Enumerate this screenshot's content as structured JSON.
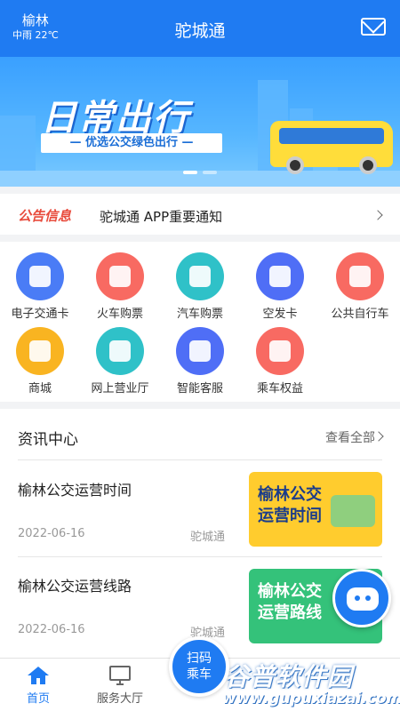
{
  "header": {
    "city": "榆林",
    "weather": "中雨 22℃",
    "title": "驼城通",
    "mail_icon": "mail-icon"
  },
  "banner": {
    "title": "日常出行",
    "subtitle": "— 优选公交绿色出行 —",
    "slides": 2,
    "active_slide": 1
  },
  "notice": {
    "tag": "公告信息",
    "text": "驼城通 APP重要通知"
  },
  "services": [
    {
      "label": "电子交通卡",
      "icon": "qr-card-icon",
      "color": "#4a7cf6"
    },
    {
      "label": "火车购票",
      "icon": "train-icon",
      "color": "#f86a62"
    },
    {
      "label": "汽车购票",
      "icon": "bus-icon",
      "color": "#2fc1c8"
    },
    {
      "label": "空发卡",
      "icon": "card-icon",
      "color": "#4f6ef6"
    },
    {
      "label": "公共自行车",
      "icon": "bicycle-icon",
      "color": "#f86a62"
    },
    {
      "label": "商城",
      "icon": "shopping-bag-icon",
      "color": "#f9b421"
    },
    {
      "label": "网上营业厅",
      "icon": "store-icon",
      "color": "#2fc1c8"
    },
    {
      "label": "智能客服",
      "icon": "robot-icon",
      "color": "#4f6ef6"
    },
    {
      "label": "乘车权益",
      "icon": "diamond-icon",
      "color": "#f86a62"
    }
  ],
  "news": {
    "title": "资讯中心",
    "more": "查看全部",
    "items": [
      {
        "title": "榆林公交运营时间",
        "date": "2022-06-16",
        "source": "驼城通",
        "thumb_text": "榆林公交运营时间"
      },
      {
        "title": "榆林公交运营线路",
        "date": "2022-06-16",
        "source": "驼城通",
        "thumb_text": "榆林公交运营路线"
      }
    ]
  },
  "scan": {
    "line1": "扫码",
    "line2": "乘车"
  },
  "tabs": [
    {
      "label": "首页",
      "icon": "home-icon",
      "active": true
    },
    {
      "label": "服务大厅",
      "icon": "monitor-icon",
      "active": false
    }
  ],
  "watermark": {
    "text": "谷普软件园",
    "url": "www.gupuxiazai.com"
  },
  "colors": {
    "primary": "#1f7bf2",
    "notice": "#e84b3c",
    "text": "#222222",
    "muted": "#999999"
  }
}
